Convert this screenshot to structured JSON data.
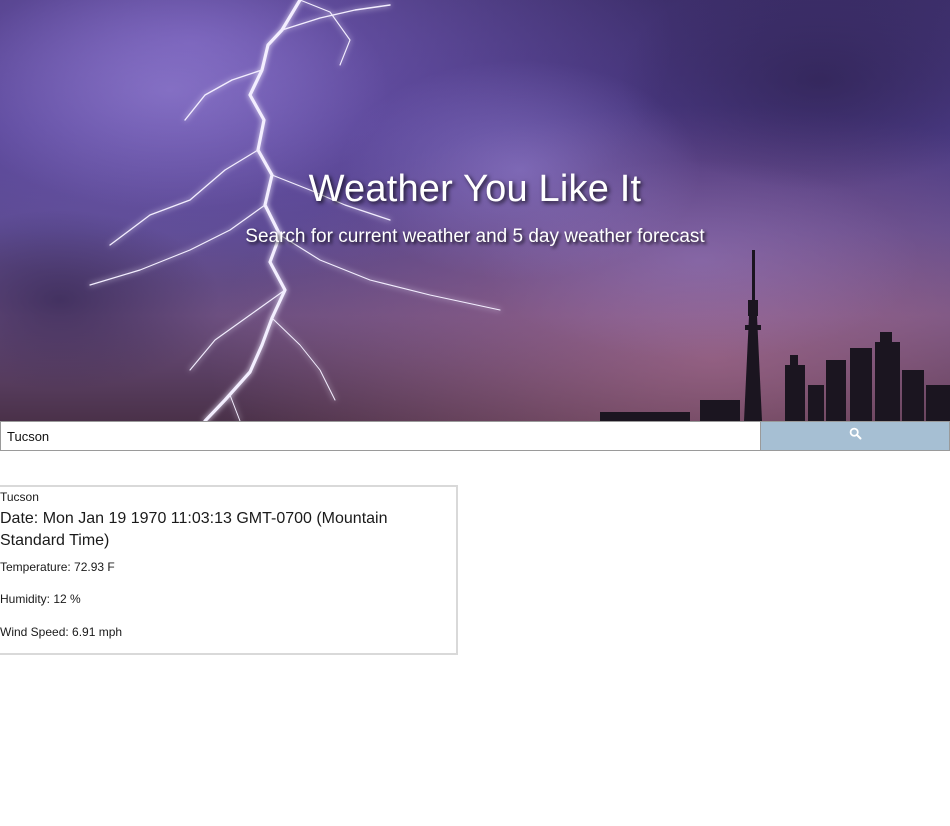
{
  "hero": {
    "title": "Weather You Like It",
    "subtitle": "Search for current weather and 5 day weather forecast"
  },
  "search": {
    "value": "Tucson",
    "button_icon": "search-icon",
    "button_color": "#a6bfd3"
  },
  "result": {
    "city": "Tucson",
    "date": "Date: Mon Jan 19 1970 11:03:13 GMT-0700 (Mountain Standard Time)",
    "temperature": "Temperature: 72.93 F",
    "humidity": "Humidity: 12 %",
    "wind_speed": "Wind Speed: 6.91 mph"
  }
}
